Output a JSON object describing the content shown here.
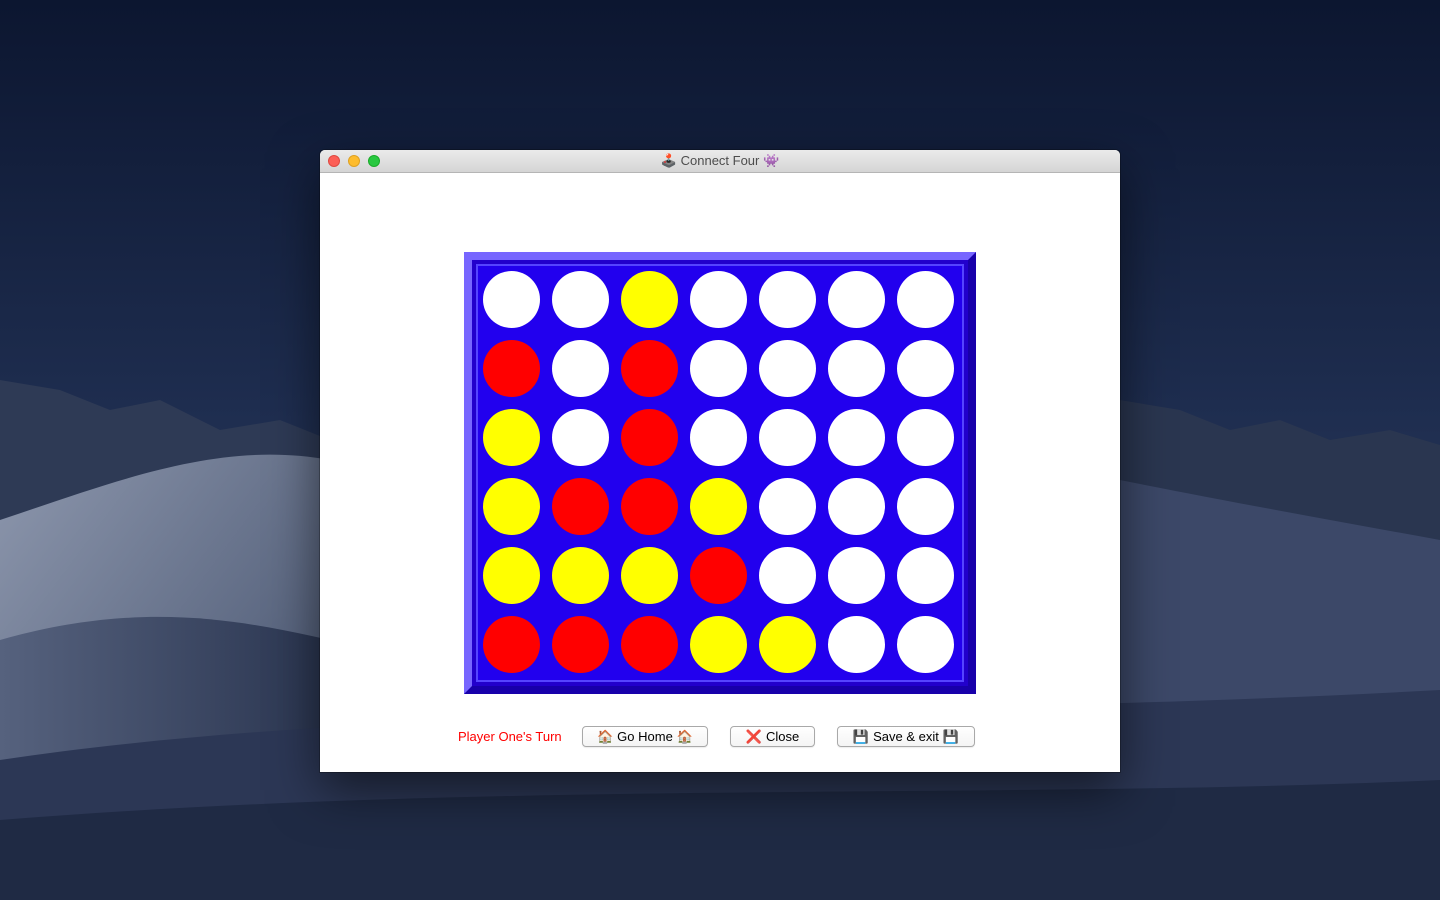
{
  "window": {
    "title_prefix_icon": "🕹️",
    "title": "Connect Four",
    "title_suffix_icon": "👾"
  },
  "board": {
    "rows": 6,
    "cols": 7,
    "colors": {
      "empty": "#ffffff",
      "red": "#ff0000",
      "yellow": "#ffff00",
      "board": "#2200ee"
    },
    "cells": [
      [
        "empty",
        "empty",
        "yellow",
        "empty",
        "empty",
        "empty",
        "empty"
      ],
      [
        "red",
        "empty",
        "red",
        "empty",
        "empty",
        "empty",
        "empty"
      ],
      [
        "yellow",
        "empty",
        "red",
        "empty",
        "empty",
        "empty",
        "empty"
      ],
      [
        "yellow",
        "red",
        "red",
        "yellow",
        "empty",
        "empty",
        "empty"
      ],
      [
        "yellow",
        "yellow",
        "yellow",
        "red",
        "empty",
        "empty",
        "empty"
      ],
      [
        "red",
        "red",
        "red",
        "yellow",
        "yellow",
        "empty",
        "empty"
      ]
    ]
  },
  "status": {
    "text": "Player One's Turn",
    "color": "#ff0000"
  },
  "buttons": {
    "home": {
      "icon": "🏠",
      "label": "Go Home"
    },
    "close": {
      "icon": "❌",
      "label": "Close"
    },
    "save": {
      "icon": "💾",
      "label": "Save & exit"
    }
  }
}
